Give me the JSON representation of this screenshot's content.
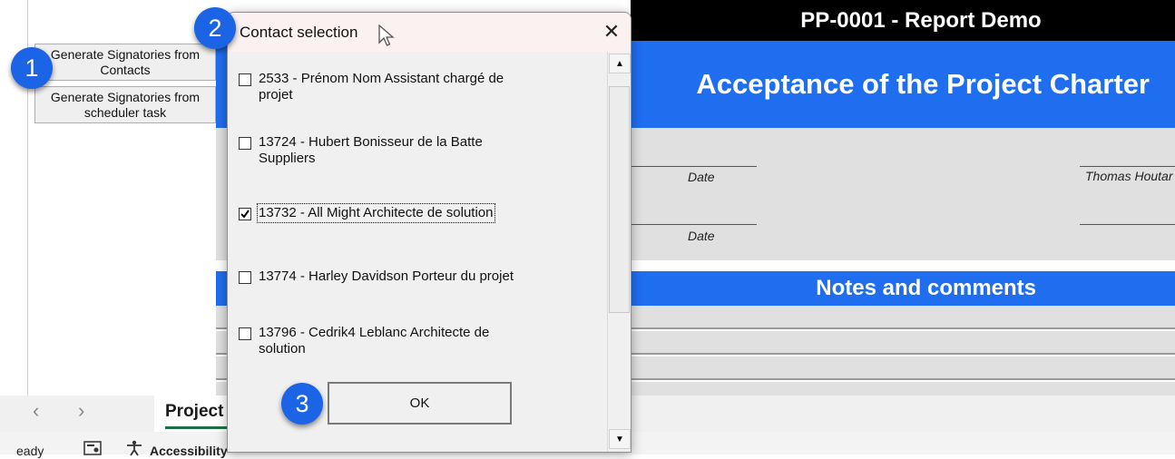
{
  "spreadsheet": {
    "title_bar": "PP-0001 - Report Demo",
    "banner": "Acceptance of the Project Charter",
    "date_label_1": "Date",
    "date_label_2": "Date",
    "signatory_name": "Thomas Houtar",
    "notes_header": "Notes and comments",
    "sheet_tab": "Project",
    "status": {
      "ready": "eady",
      "accessibility": "Accessibility"
    }
  },
  "buttons": {
    "generate_from_contacts": "Generate Signatories from Contacts",
    "generate_from_scheduler": "Generate Signatories from scheduler task"
  },
  "dialog": {
    "title": "Contact selection",
    "close_glyph": "✕",
    "items": [
      {
        "label": "2533 - Prénom Nom Assistant chargé de projet",
        "checked": false
      },
      {
        "label": "13724 - Hubert Bonisseur de la Batte Suppliers",
        "checked": false
      },
      {
        "label": "13732 - All Might Architecte de solution",
        "checked": true
      },
      {
        "label": "13774 - Harley Davidson Porteur du projet",
        "checked": false
      },
      {
        "label": "13796 - Cedrik4 Leblanc Architecte de solution",
        "checked": false
      }
    ],
    "ok_label": "OK"
  },
  "badges": [
    "1",
    "2",
    "3"
  ],
  "nav": {
    "prev": "‹",
    "next": "›"
  },
  "colors": {
    "accent_blue": "#1f6ef0",
    "badge_blue": "#1b64e6",
    "title_black": "#000000"
  }
}
